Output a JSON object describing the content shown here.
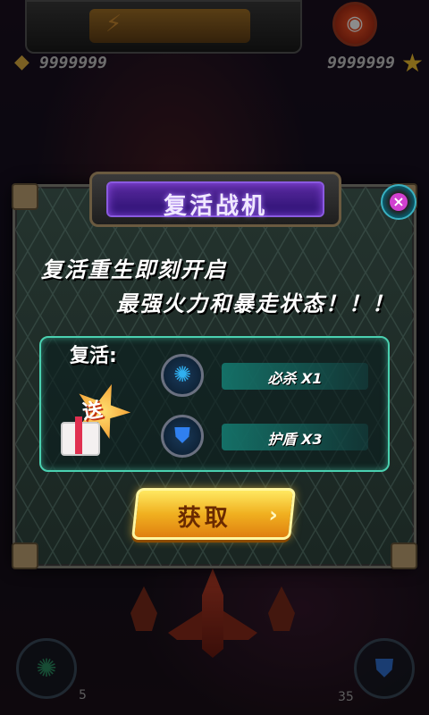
{
  "hud": {
    "gems": "9999999",
    "stars": "9999999",
    "energy_icon": "lightning-icon",
    "bomb_icon": "bomb-icon",
    "gem_icon": "diamond-icon",
    "star_icon": "star-icon"
  },
  "dialog": {
    "title": "复活战机",
    "headline1": "复活重生即刻开启",
    "headline2": "最强火力和暴走状态！！！",
    "revive_label": "复活:",
    "gift_label": "送",
    "rewards": [
      {
        "label": "必杀 X1",
        "icon": "special-attack-icon"
      },
      {
        "label": "护盾 X3",
        "icon": "shield-icon"
      }
    ],
    "get_button": "获取",
    "close_icon": "close-icon"
  },
  "bottom": {
    "left_count": "5",
    "right_count": "35"
  },
  "colors": {
    "accent_teal": "#4ad0b0",
    "title_purple": "#5a2aa0",
    "button_gold": "#f0b020"
  }
}
